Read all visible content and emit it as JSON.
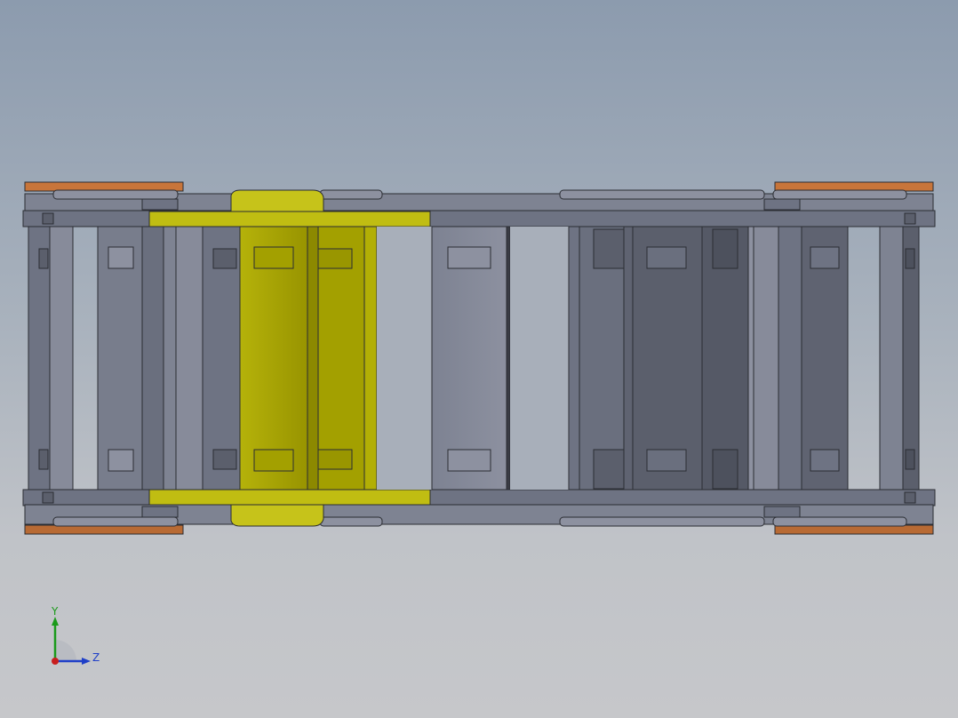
{
  "viewport": {
    "model": "cable-drag-chain-assembly",
    "colors": {
      "background_top": "#8c9bae",
      "background_bottom": "#c6c7ca",
      "link_light": "#878b9a",
      "link_mid": "#6e7383",
      "link_dark": "#5b5f6c",
      "edge": "#2b2d33",
      "selected_link": "#a3a000",
      "end_bracket": "#c8753a"
    }
  },
  "triad": {
    "y_label": "Y",
    "z_label": "Z",
    "colors": {
      "y": "#1a9a1a",
      "z": "#1f3fc8",
      "x": "#c81e1e"
    }
  }
}
